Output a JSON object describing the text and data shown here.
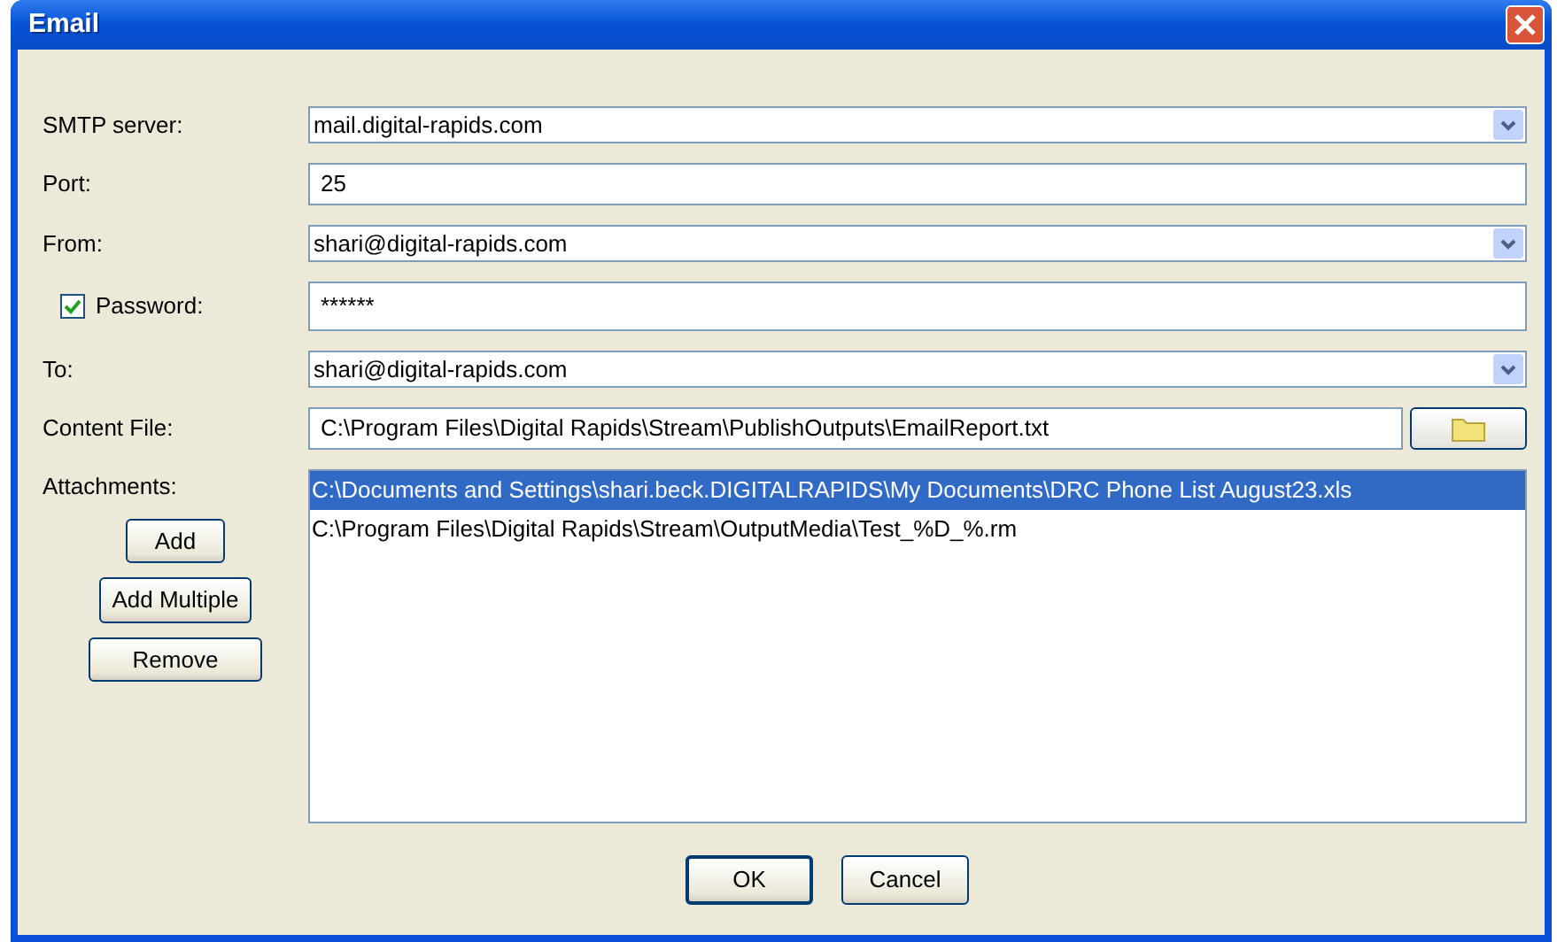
{
  "window": {
    "title": "Email"
  },
  "fields": [
    {
      "kind": "combo",
      "label": "SMTP server:",
      "value": "mail.digital-rapids.com"
    },
    {
      "kind": "text",
      "label": "Port:",
      "value": "25"
    },
    {
      "kind": "combo",
      "label": "From:",
      "value": "shari@digital-rapids.com"
    },
    {
      "kind": "password",
      "label": "Password:",
      "checked": true,
      "value": "******"
    },
    {
      "kind": "combo",
      "label": "To:",
      "value": "shari@digital-rapids.com"
    },
    {
      "kind": "file",
      "label": "Content File:",
      "value": "C:\\Program Files\\Digital Rapids\\Stream\\PublishOutputs\\EmailReport.txt"
    }
  ],
  "attachments": {
    "label": "Attachments:",
    "buttons": [
      "Add",
      "Add Multiple",
      "Remove"
    ],
    "items": [
      {
        "text": "C:\\Documents and Settings\\shari.beck.DIGITALRAPIDS\\My Documents\\DRC Phone List August23.xls",
        "selected": true
      },
      {
        "text": "C:\\Program Files\\Digital Rapids\\Stream\\OutputMedia\\Test_%D_%.rm",
        "selected": false
      }
    ]
  },
  "buttons": [
    "OK",
    "Cancel"
  ]
}
